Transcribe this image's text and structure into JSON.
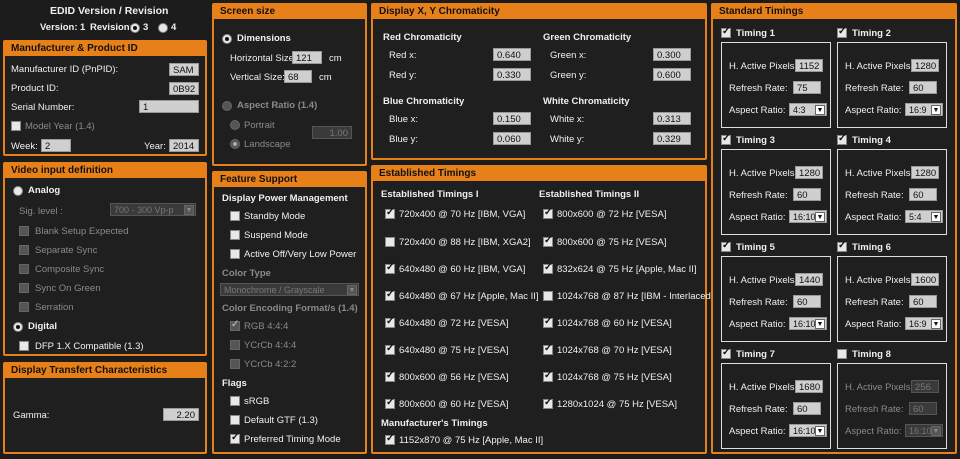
{
  "edid": {
    "title": "EDID Version / Revision",
    "version_label": "Version:",
    "version_value": "1",
    "revision_label": "Revision:",
    "rev3": "3",
    "rev4": "4"
  },
  "manufacturer": {
    "title": "Manufacturer & Product ID",
    "mid_label": "Manufacturer ID (PnPID):",
    "mid_value": "SAM",
    "pid_label": "Product ID:",
    "pid_value": "0B92",
    "serial_label": "Serial Number:",
    "serial_value": "1",
    "modelyear_label": "Model Year (1.4)",
    "week_label": "Week:",
    "week_value": "2",
    "year_label": "Year:",
    "year_value": "2014"
  },
  "video": {
    "title": "Video input definition",
    "analog": "Analog",
    "sig_label": "Sig. level :",
    "sig_value": "700 - 300 Vp-p",
    "blank": "Blank Setup Expected",
    "sep": "Separate Sync",
    "comp": "Composite Sync",
    "sog": "Sync On Green",
    "serr": "Serration",
    "digital": "Digital",
    "dfp": "DFP 1.X Compatible (1.3)"
  },
  "transfer": {
    "title": "Display Transfert Characteristics",
    "gamma_label": "Gamma:",
    "gamma_value": "2.20"
  },
  "screen": {
    "title": "Screen size",
    "dimensions": "Dimensions",
    "hsize_label": "Horizontal Size:",
    "hsize_value": "121",
    "vsize_label": "Vertical Size:",
    "vsize_value": "68",
    "unit": "cm",
    "aspect": "Aspect Ratio (1.4)",
    "portrait": "Portrait",
    "landscape": "Landscape",
    "aspect_value": "1.00"
  },
  "feature": {
    "title": "Feature Support",
    "dpm": "Display Power Management",
    "standby": "Standby Mode",
    "suspend": "Suspend Mode",
    "activeoff": "Active Off/Very Low Power",
    "colortype": "Color Type",
    "colortype_value": "Monochrome / Grayscale",
    "encoding": "Color Encoding Format/s (1.4)",
    "rgb444": "RGB 4:4:4",
    "ycrcb444": "YCrCb 4:4:4",
    "ycrcb422": "YCrCb 4:2:2",
    "flags": "Flags",
    "srgb": "sRGB",
    "gtf": "Default GTF (1.3)",
    "ptm": "Preferred Timing Mode"
  },
  "chroma": {
    "title": "Display X, Y Chromaticity",
    "red": "Red Chromaticity",
    "green": "Green Chromaticity",
    "blue": "Blue Chromaticity",
    "white": "White Chromaticity",
    "redx_label": "Red x:",
    "redx": "0.640",
    "redy_label": "Red y:",
    "redy": "0.330",
    "greenx_label": "Green x:",
    "greenx": "0.300",
    "greeny_label": "Green y:",
    "greeny": "0.600",
    "bluex_label": "Blue x:",
    "bluex": "0.150",
    "bluey_label": "Blue y:",
    "bluey": "0.060",
    "whitex_label": "White x:",
    "whitex": "0.313",
    "whitey_label": "White y:",
    "whitey": "0.329"
  },
  "established": {
    "title": "Established Timings",
    "col1": "Established Timings I",
    "col2": "Established Timings II",
    "mfr": "Manufacturer's Timings",
    "t1": [
      {
        "label": "720x400 @ 70 Hz [IBM, VGA]",
        "on": true
      },
      {
        "label": "720x400 @ 88 Hz [IBM, XGA2]",
        "on": false
      },
      {
        "label": "640x480 @ 60 Hz [IBM, VGA]",
        "on": true
      },
      {
        "label": "640x480 @ 67 Hz [Apple, Mac II]",
        "on": true
      },
      {
        "label": "640x480 @ 72 Hz [VESA]",
        "on": true
      },
      {
        "label": "640x480 @ 75 Hz [VESA]",
        "on": true
      },
      {
        "label": "800x600 @ 56 Hz [VESA]",
        "on": true
      },
      {
        "label": "800x600 @ 60 Hz [VESA]",
        "on": true
      }
    ],
    "t2": [
      {
        "label": "800x600 @ 72 Hz [VESA]",
        "on": true
      },
      {
        "label": "800x600 @ 75 Hz [VESA]",
        "on": true
      },
      {
        "label": "832x624 @ 75 Hz [Apple, Mac II]",
        "on": true
      },
      {
        "label": "1024x768 @ 87 Hz [IBM - Interlaced]",
        "on": false
      },
      {
        "label": "1024x768 @ 60 Hz [VESA]",
        "on": true
      },
      {
        "label": "1024x768 @ 70 Hz [VESA]",
        "on": true
      },
      {
        "label": "1024x768 @ 75 Hz [VESA]",
        "on": true
      },
      {
        "label": "1280x1024 @ 75 Hz [VESA]",
        "on": true
      }
    ],
    "m1": "1152x870 @ 75 Hz [Apple, Mac II]"
  },
  "standard": {
    "title": "Standard Timings",
    "hap_label": "H. Active Pixels:",
    "rr_label": "Refresh Rate:",
    "ar_label": "Aspect Ratio:",
    "timings": [
      {
        "name": "Timing 1",
        "on": true,
        "hap": "1152",
        "rr": "75",
        "ar": "4:3"
      },
      {
        "name": "Timing 2",
        "on": true,
        "hap": "1280",
        "rr": "60",
        "ar": "16:9"
      },
      {
        "name": "Timing 3",
        "on": true,
        "hap": "1280",
        "rr": "60",
        "ar": "16:10"
      },
      {
        "name": "Timing 4",
        "on": true,
        "hap": "1280",
        "rr": "60",
        "ar": "5:4"
      },
      {
        "name": "Timing 5",
        "on": true,
        "hap": "1440",
        "rr": "60",
        "ar": "16:10"
      },
      {
        "name": "Timing 6",
        "on": true,
        "hap": "1600",
        "rr": "60",
        "ar": "16:9"
      },
      {
        "name": "Timing 7",
        "on": true,
        "hap": "1680",
        "rr": "60",
        "ar": "16:10"
      },
      {
        "name": "Timing 8",
        "on": false,
        "hap": "256",
        "rr": "60",
        "ar": "16:10"
      }
    ]
  }
}
